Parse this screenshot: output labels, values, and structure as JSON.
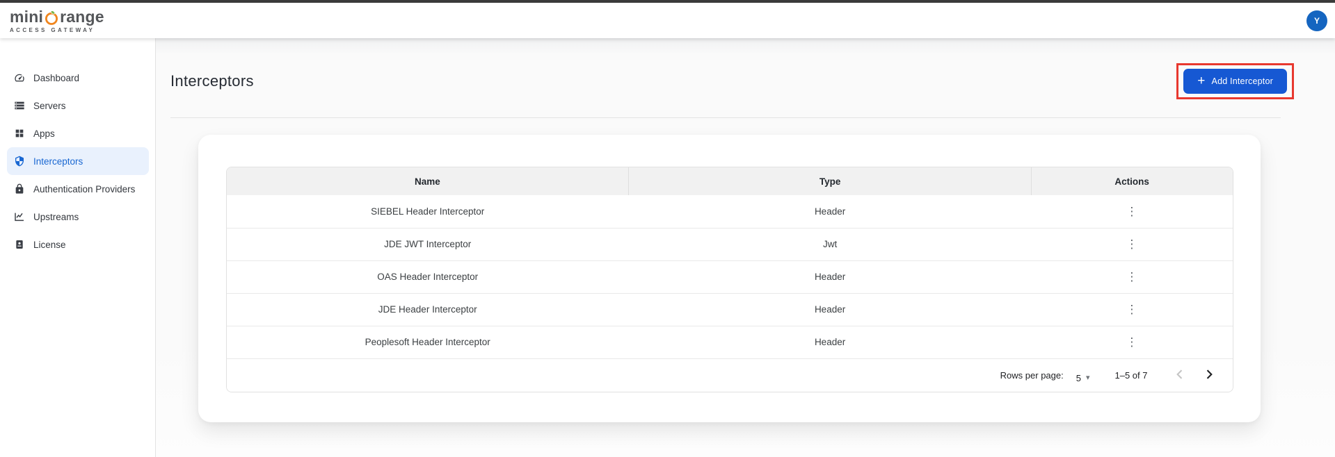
{
  "topbar": {
    "logo": {
      "part1": "mini",
      "part2": "range",
      "subtitle": "ACCESS GATEWAY",
      "ring_icon": "orange-ring-leaf-icon"
    },
    "avatar_text": "Y"
  },
  "sidebar": {
    "items": [
      {
        "label": "Dashboard",
        "icon": "dashboard-icon",
        "active": false
      },
      {
        "label": "Servers",
        "icon": "servers-icon",
        "active": false
      },
      {
        "label": "Apps",
        "icon": "apps-icon",
        "active": false
      },
      {
        "label": "Interceptors",
        "icon": "shield-icon",
        "active": true
      },
      {
        "label": "Authentication Providers",
        "icon": "lock-icon",
        "active": false
      },
      {
        "label": "Upstreams",
        "icon": "chart-icon",
        "active": false
      },
      {
        "label": "License",
        "icon": "license-icon",
        "active": false
      }
    ]
  },
  "main": {
    "title": "Interceptors",
    "add_button": {
      "label": "Add Interceptor",
      "icon": "plus-icon",
      "highlighted": true
    },
    "table": {
      "columns": [
        "Name",
        "Type",
        "Actions"
      ],
      "rows": [
        {
          "name": "SIEBEL Header Interceptor",
          "type": "Header"
        },
        {
          "name": "JDE JWT Interceptor",
          "type": "Jwt"
        },
        {
          "name": "OAS Header Interceptor",
          "type": "Header"
        },
        {
          "name": "JDE Header Interceptor",
          "type": "Header"
        },
        {
          "name": "Peoplesoft Header Interceptor",
          "type": "Header"
        }
      ],
      "pagination": {
        "rows_per_page_label": "Rows per page:",
        "rows_per_page_value": "5",
        "range_label": "1–5 of 7",
        "prev_enabled": false,
        "next_enabled": true
      }
    }
  },
  "icons": {
    "plus_glyph": "+",
    "kebab_glyph": "⋮",
    "dropdown_arrow_glyph": "▾"
  },
  "colors": {
    "accent_blue": "#1658d3",
    "sidebar_active_blue": "#1967d2",
    "sidebar_active_bg": "#e9f1fd",
    "avatar_blue": "#1565c0",
    "logo_orange": "#f0861f",
    "logo_green": "#7ab648",
    "logo_gray": "#55575a",
    "highlight_red": "#e8382f",
    "title_color": "#262b33"
  }
}
